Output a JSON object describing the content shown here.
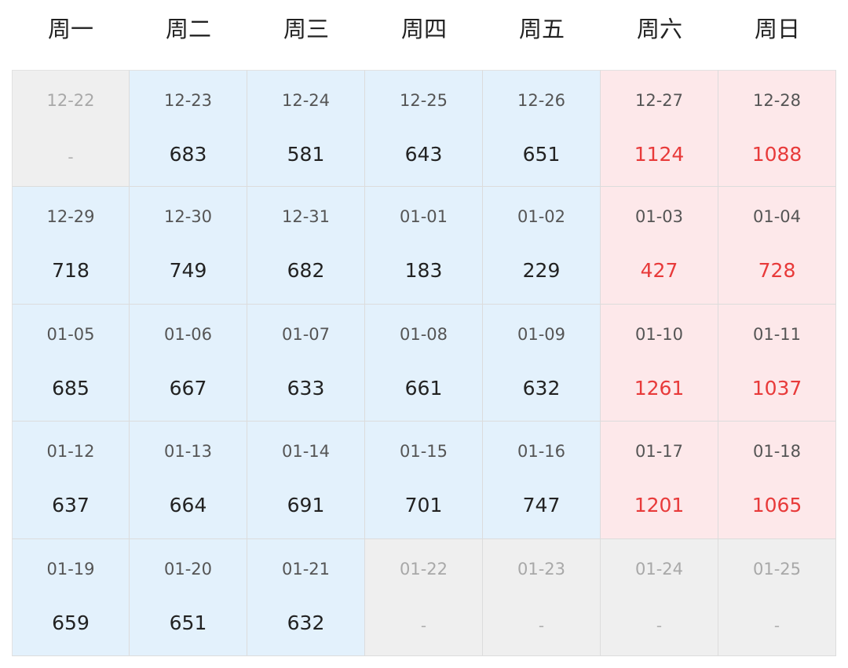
{
  "weekdays": [
    "周一",
    "周二",
    "周三",
    "周四",
    "周五",
    "周六",
    "周日"
  ],
  "colors": {
    "weekday_bg": "#e3f1fc",
    "weekend_bg": "#fde8ea",
    "empty_bg": "#efefef",
    "weekend_value": "#e83a3a"
  },
  "weeks": [
    [
      {
        "date": "12-22",
        "value": "-",
        "kind": "empty"
      },
      {
        "date": "12-23",
        "value": "683",
        "kind": "weekday"
      },
      {
        "date": "12-24",
        "value": "581",
        "kind": "weekday"
      },
      {
        "date": "12-25",
        "value": "643",
        "kind": "weekday"
      },
      {
        "date": "12-26",
        "value": "651",
        "kind": "weekday"
      },
      {
        "date": "12-27",
        "value": "1124",
        "kind": "weekend"
      },
      {
        "date": "12-28",
        "value": "1088",
        "kind": "weekend"
      }
    ],
    [
      {
        "date": "12-29",
        "value": "718",
        "kind": "weekday"
      },
      {
        "date": "12-30",
        "value": "749",
        "kind": "weekday"
      },
      {
        "date": "12-31",
        "value": "682",
        "kind": "weekday"
      },
      {
        "date": "01-01",
        "value": "183",
        "kind": "weekday"
      },
      {
        "date": "01-02",
        "value": "229",
        "kind": "weekday"
      },
      {
        "date": "01-03",
        "value": "427",
        "kind": "weekend"
      },
      {
        "date": "01-04",
        "value": "728",
        "kind": "weekend"
      }
    ],
    [
      {
        "date": "01-05",
        "value": "685",
        "kind": "weekday"
      },
      {
        "date": "01-06",
        "value": "667",
        "kind": "weekday"
      },
      {
        "date": "01-07",
        "value": "633",
        "kind": "weekday"
      },
      {
        "date": "01-08",
        "value": "661",
        "kind": "weekday"
      },
      {
        "date": "01-09",
        "value": "632",
        "kind": "weekday"
      },
      {
        "date": "01-10",
        "value": "1261",
        "kind": "weekend"
      },
      {
        "date": "01-11",
        "value": "1037",
        "kind": "weekend"
      }
    ],
    [
      {
        "date": "01-12",
        "value": "637",
        "kind": "weekday"
      },
      {
        "date": "01-13",
        "value": "664",
        "kind": "weekday"
      },
      {
        "date": "01-14",
        "value": "691",
        "kind": "weekday"
      },
      {
        "date": "01-15",
        "value": "701",
        "kind": "weekday"
      },
      {
        "date": "01-16",
        "value": "747",
        "kind": "weekday"
      },
      {
        "date": "01-17",
        "value": "1201",
        "kind": "weekend"
      },
      {
        "date": "01-18",
        "value": "1065",
        "kind": "weekend"
      }
    ],
    [
      {
        "date": "01-19",
        "value": "659",
        "kind": "weekday"
      },
      {
        "date": "01-20",
        "value": "651",
        "kind": "weekday"
      },
      {
        "date": "01-21",
        "value": "632",
        "kind": "weekday"
      },
      {
        "date": "01-22",
        "value": "-",
        "kind": "empty"
      },
      {
        "date": "01-23",
        "value": "-",
        "kind": "empty"
      },
      {
        "date": "01-24",
        "value": "-",
        "kind": "empty"
      },
      {
        "date": "01-25",
        "value": "-",
        "kind": "empty"
      }
    ]
  ]
}
